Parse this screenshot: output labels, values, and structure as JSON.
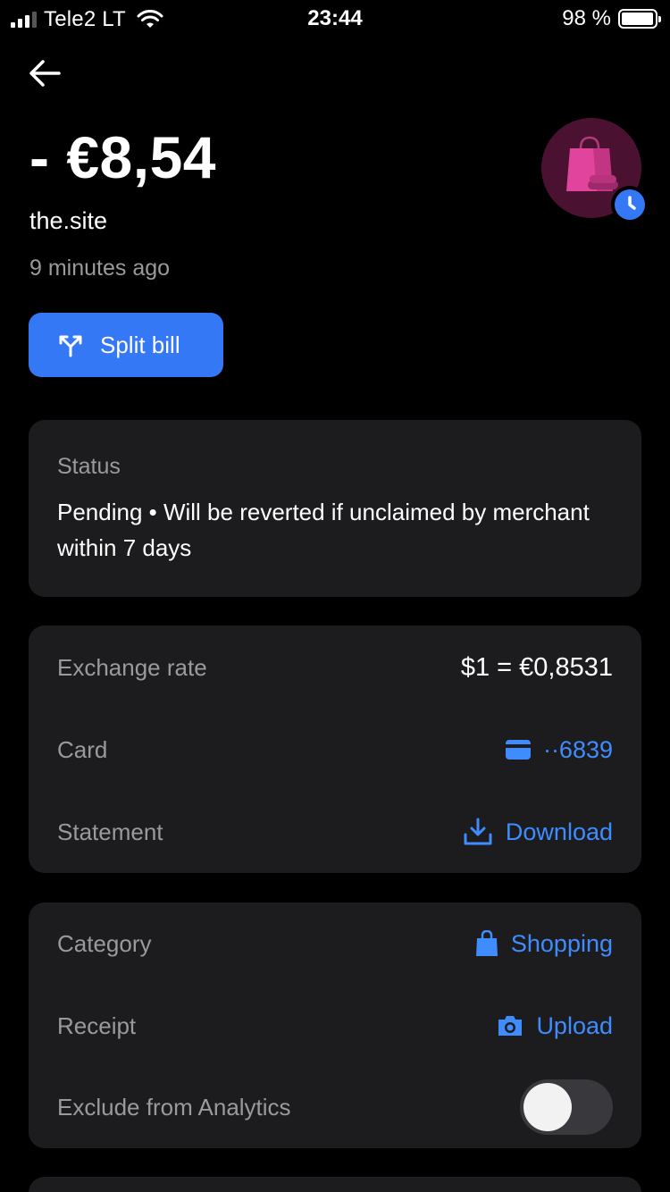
{
  "status_bar": {
    "carrier": "Tele2 LT",
    "time": "23:44",
    "battery": "98 %",
    "battery_level": 0.98
  },
  "transaction": {
    "amount": "- €8,54",
    "merchant": "the.site",
    "time_ago": "9 minutes ago"
  },
  "actions": {
    "split_bill_label": "Split bill"
  },
  "status_card": {
    "title": "Status",
    "text": "Pending • Will be reverted if unclaimed by merchant within 7 days"
  },
  "details": {
    "exchange_rate_label": "Exchange rate",
    "exchange_rate_value": "$1 = €0,8531",
    "card_label": "Card",
    "card_value": "··6839",
    "statement_label": "Statement",
    "statement_value": "Download"
  },
  "meta": {
    "category_label": "Category",
    "category_value": "Shopping",
    "receipt_label": "Receipt",
    "receipt_value": "Upload",
    "exclude_label": "Exclude from Analytics",
    "exclude_enabled": false
  },
  "colors": {
    "accent": "#3478f6",
    "link": "#3f8cff",
    "card_bg": "#1c1c1e",
    "muted_text": "#9a9a9e",
    "avatar_bg": "#4a1230",
    "shopping_bag": "#e0449c"
  },
  "icons": [
    "back-arrow-icon",
    "shopping-bag-icon",
    "clock-icon",
    "split-icon",
    "card-icon",
    "download-icon",
    "bag-icon",
    "camera-icon",
    "wifi-icon",
    "signal-icon",
    "battery-icon"
  ]
}
